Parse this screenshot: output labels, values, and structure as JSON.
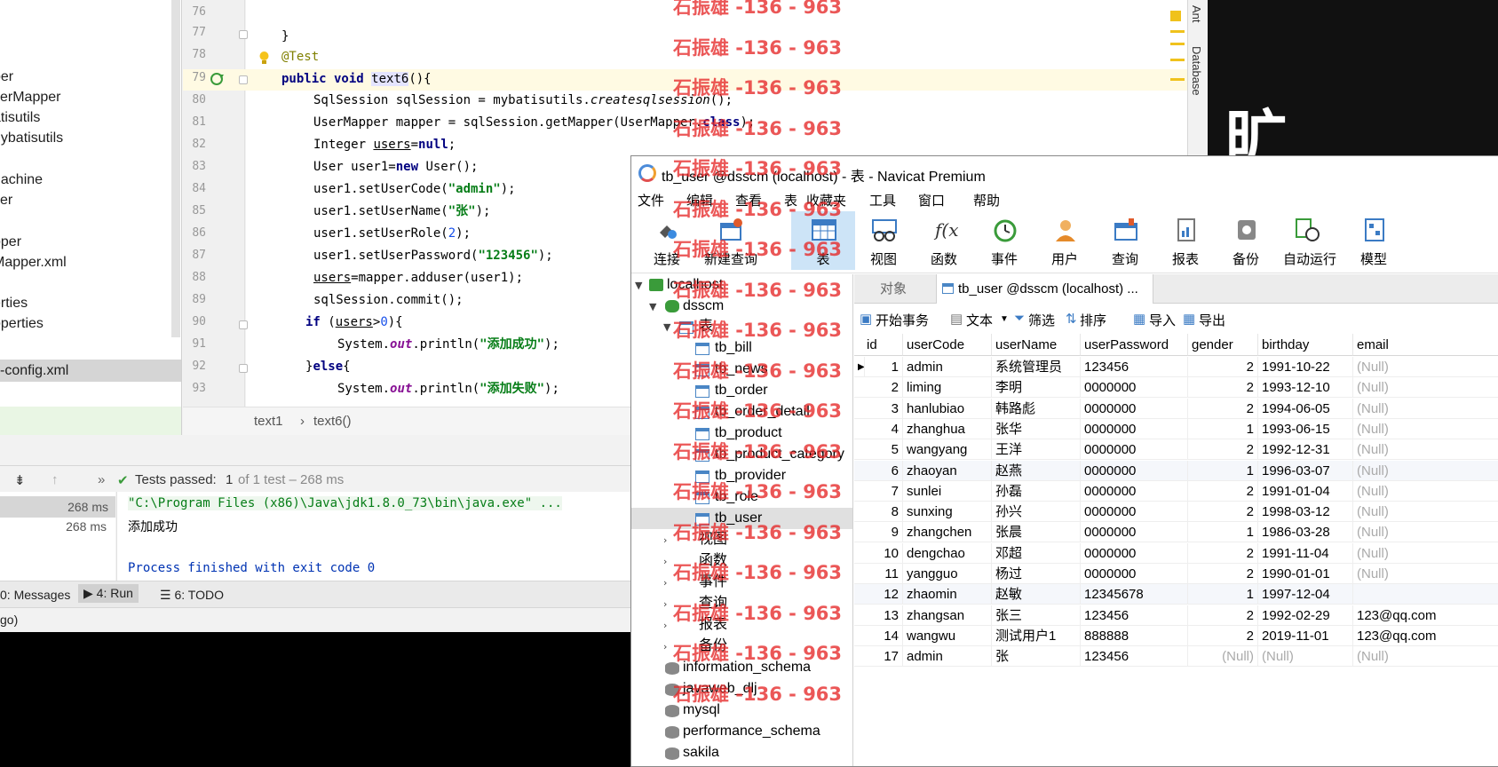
{
  "ide": {
    "project_items": [
      "per",
      "serMapper",
      "atisutils",
      "nybatisutils",
      "",
      "nachine",
      "ser",
      "",
      "pper",
      "Mapper.xml",
      "",
      "erties",
      "operties",
      "-config.xml"
    ],
    "line_numbers": [
      "76",
      "77",
      "78",
      "79",
      "80",
      "81",
      "82",
      "83",
      "84",
      "85",
      "86",
      "87",
      "88",
      "89",
      "90",
      "91",
      "92",
      "93"
    ],
    "code": {
      "l77": "}",
      "l78": "@Test",
      "l79_a": "public void ",
      "l79_b": "text6",
      "l79_c": "(){",
      "l80_a": "SqlSession sqlSession = mybatisutils.",
      "l80_b": "createsqlsession",
      "l80_c": "();",
      "l81_a": "UserMapper mapper = sqlSession.getMapper(UserMapper.",
      "l81_b": "class",
      "l81_c": ");",
      "l82_a": "Integer ",
      "l82_b": "users",
      "l82_c": "=",
      "l82_d": "null",
      "l82_e": ";",
      "l83_a": "User user1=",
      "l83_b": "new",
      "l83_c": " User();",
      "l84_a": "user1.setUserCode(",
      "l84_b": "\"admin\"",
      "l84_c": ");",
      "l85_a": "user1.setUserName(",
      "l85_b": "\"张\"",
      "l85_c": ");",
      "l86_a": "user1.setUserRole(",
      "l86_b": "2",
      "l86_c": ");",
      "l87_a": "user1.setUserPassword(",
      "l87_b": "\"123456\"",
      "l87_c": ");",
      "l88_a": "users",
      "l88_b": "=mapper.adduser(user1);",
      "l89": "sqlSession.commit();",
      "l90_a": "if",
      "l90_b": " (",
      "l90_c": "users",
      "l90_d": ">",
      "l90_e": "0",
      "l90_f": "){",
      "l91_a": "System.",
      "l91_b": "out",
      "l91_c": ".println(",
      "l91_d": "\"添加成功\"",
      "l91_e": ");",
      "l92_a": "}",
      "l92_b": "else",
      "l92_c": "{",
      "l93_a": "System.",
      "l93_b": "out",
      "l93_c": ".println(",
      "l93_d": "\"添加失败\"",
      "l93_e": ");"
    },
    "breadcrumb": [
      "text1",
      "›",
      "text6()"
    ],
    "right_tabs": [
      "Ant",
      "Database"
    ],
    "run": {
      "tests_passed_label": "Tests passed:",
      "tests_passed_count": "1",
      "tests_detail": "of 1 test – 268 ms",
      "durations": [
        "268 ms",
        "268 ms"
      ],
      "console": [
        "\"C:\\Program Files (x86)\\Java\\jdk1.8.0_73\\bin\\java.exe\" ...",
        "添加成功",
        "",
        "Process finished with exit code 0"
      ]
    },
    "tool_windows": [
      "0: Messages",
      "4: Run",
      "6: TODO"
    ],
    "status": "go)"
  },
  "navicat": {
    "title": "tb_user @dsscm (localhost) - 表 - Navicat Premium",
    "menu": [
      "文件",
      "编辑",
      "查看",
      "表",
      "收藏夹",
      "工具",
      "窗口",
      "帮助"
    ],
    "toolbar": [
      "连接",
      "新建查询",
      "表",
      "视图",
      "函数",
      "事件",
      "用户",
      "查询",
      "报表",
      "备份",
      "自动运行",
      "模型"
    ],
    "tree": {
      "connection": "localhost",
      "database": "dsscm",
      "tables_label": "表",
      "tables": [
        "tb_bill",
        "tb_news",
        "tb_order",
        "tb_order_detail",
        "tb_product",
        "tb_product_category",
        "tb_provider",
        "tb_role",
        "tb_user"
      ],
      "groups": [
        "视图",
        "函数",
        "事件",
        "查询",
        "报表",
        "备份"
      ],
      "other_dbs": [
        "information_schema",
        "javaweb_dlj",
        "mysql",
        "performance_schema",
        "sakila"
      ]
    },
    "tabs": [
      "对象",
      "tb_user @dsscm (localhost) ..."
    ],
    "subtoolbar": [
      "开始事务",
      "文本",
      "筛选",
      "排序",
      "导入",
      "导出"
    ],
    "columns": [
      "id",
      "userCode",
      "userName",
      "userPassword",
      "gender",
      "birthday",
      "email"
    ],
    "rows": [
      [
        "1",
        "admin",
        "系统管理员",
        "123456",
        "2",
        "1991-10-22",
        "(Null)"
      ],
      [
        "2",
        "liming",
        "李明",
        "0000000",
        "2",
        "1993-12-10",
        "(Null)"
      ],
      [
        "3",
        "hanlubiao",
        "韩路彪",
        "0000000",
        "2",
        "1994-06-05",
        "(Null)"
      ],
      [
        "4",
        "zhanghua",
        "张华",
        "0000000",
        "1",
        "1993-06-15",
        "(Null)"
      ],
      [
        "5",
        "wangyang",
        "王洋",
        "0000000",
        "2",
        "1992-12-31",
        "(Null)"
      ],
      [
        "6",
        "zhaoyan",
        "赵燕",
        "0000000",
        "1",
        "1996-03-07",
        "(Null)"
      ],
      [
        "7",
        "sunlei",
        "孙磊",
        "0000000",
        "2",
        "1991-01-04",
        "(Null)"
      ],
      [
        "8",
        "sunxing",
        "孙兴",
        "0000000",
        "2",
        "1998-03-12",
        "(Null)"
      ],
      [
        "9",
        "zhangchen",
        "张晨",
        "0000000",
        "1",
        "1986-03-28",
        "(Null)"
      ],
      [
        "10",
        "dengchao",
        "邓超",
        "0000000",
        "2",
        "1991-11-04",
        "(Null)"
      ],
      [
        "11",
        "yangguo",
        "杨过",
        "0000000",
        "2",
        "1990-01-01",
        "(Null)"
      ],
      [
        "12",
        "zhaomin",
        "赵敏",
        "12345678",
        "1",
        "1997-12-04",
        ""
      ],
      [
        "13",
        "zhangsan",
        "张三",
        "123456",
        "2",
        "1992-02-29",
        "123@qq.com"
      ],
      [
        "14",
        "wangwu",
        "测试用户1",
        "888888",
        "2",
        "2019-11-01",
        "123@qq.com"
      ],
      [
        "17",
        "admin",
        "张",
        "123456",
        "(Null)",
        "(Null)",
        "(Null)"
      ]
    ]
  },
  "background_text": "旷",
  "watermark": "石振雄 -136 - 963",
  "colors": {
    "accent": "#cde4f7",
    "watermark": "#e62828",
    "keyword": "#000080",
    "string": "#067d17"
  }
}
